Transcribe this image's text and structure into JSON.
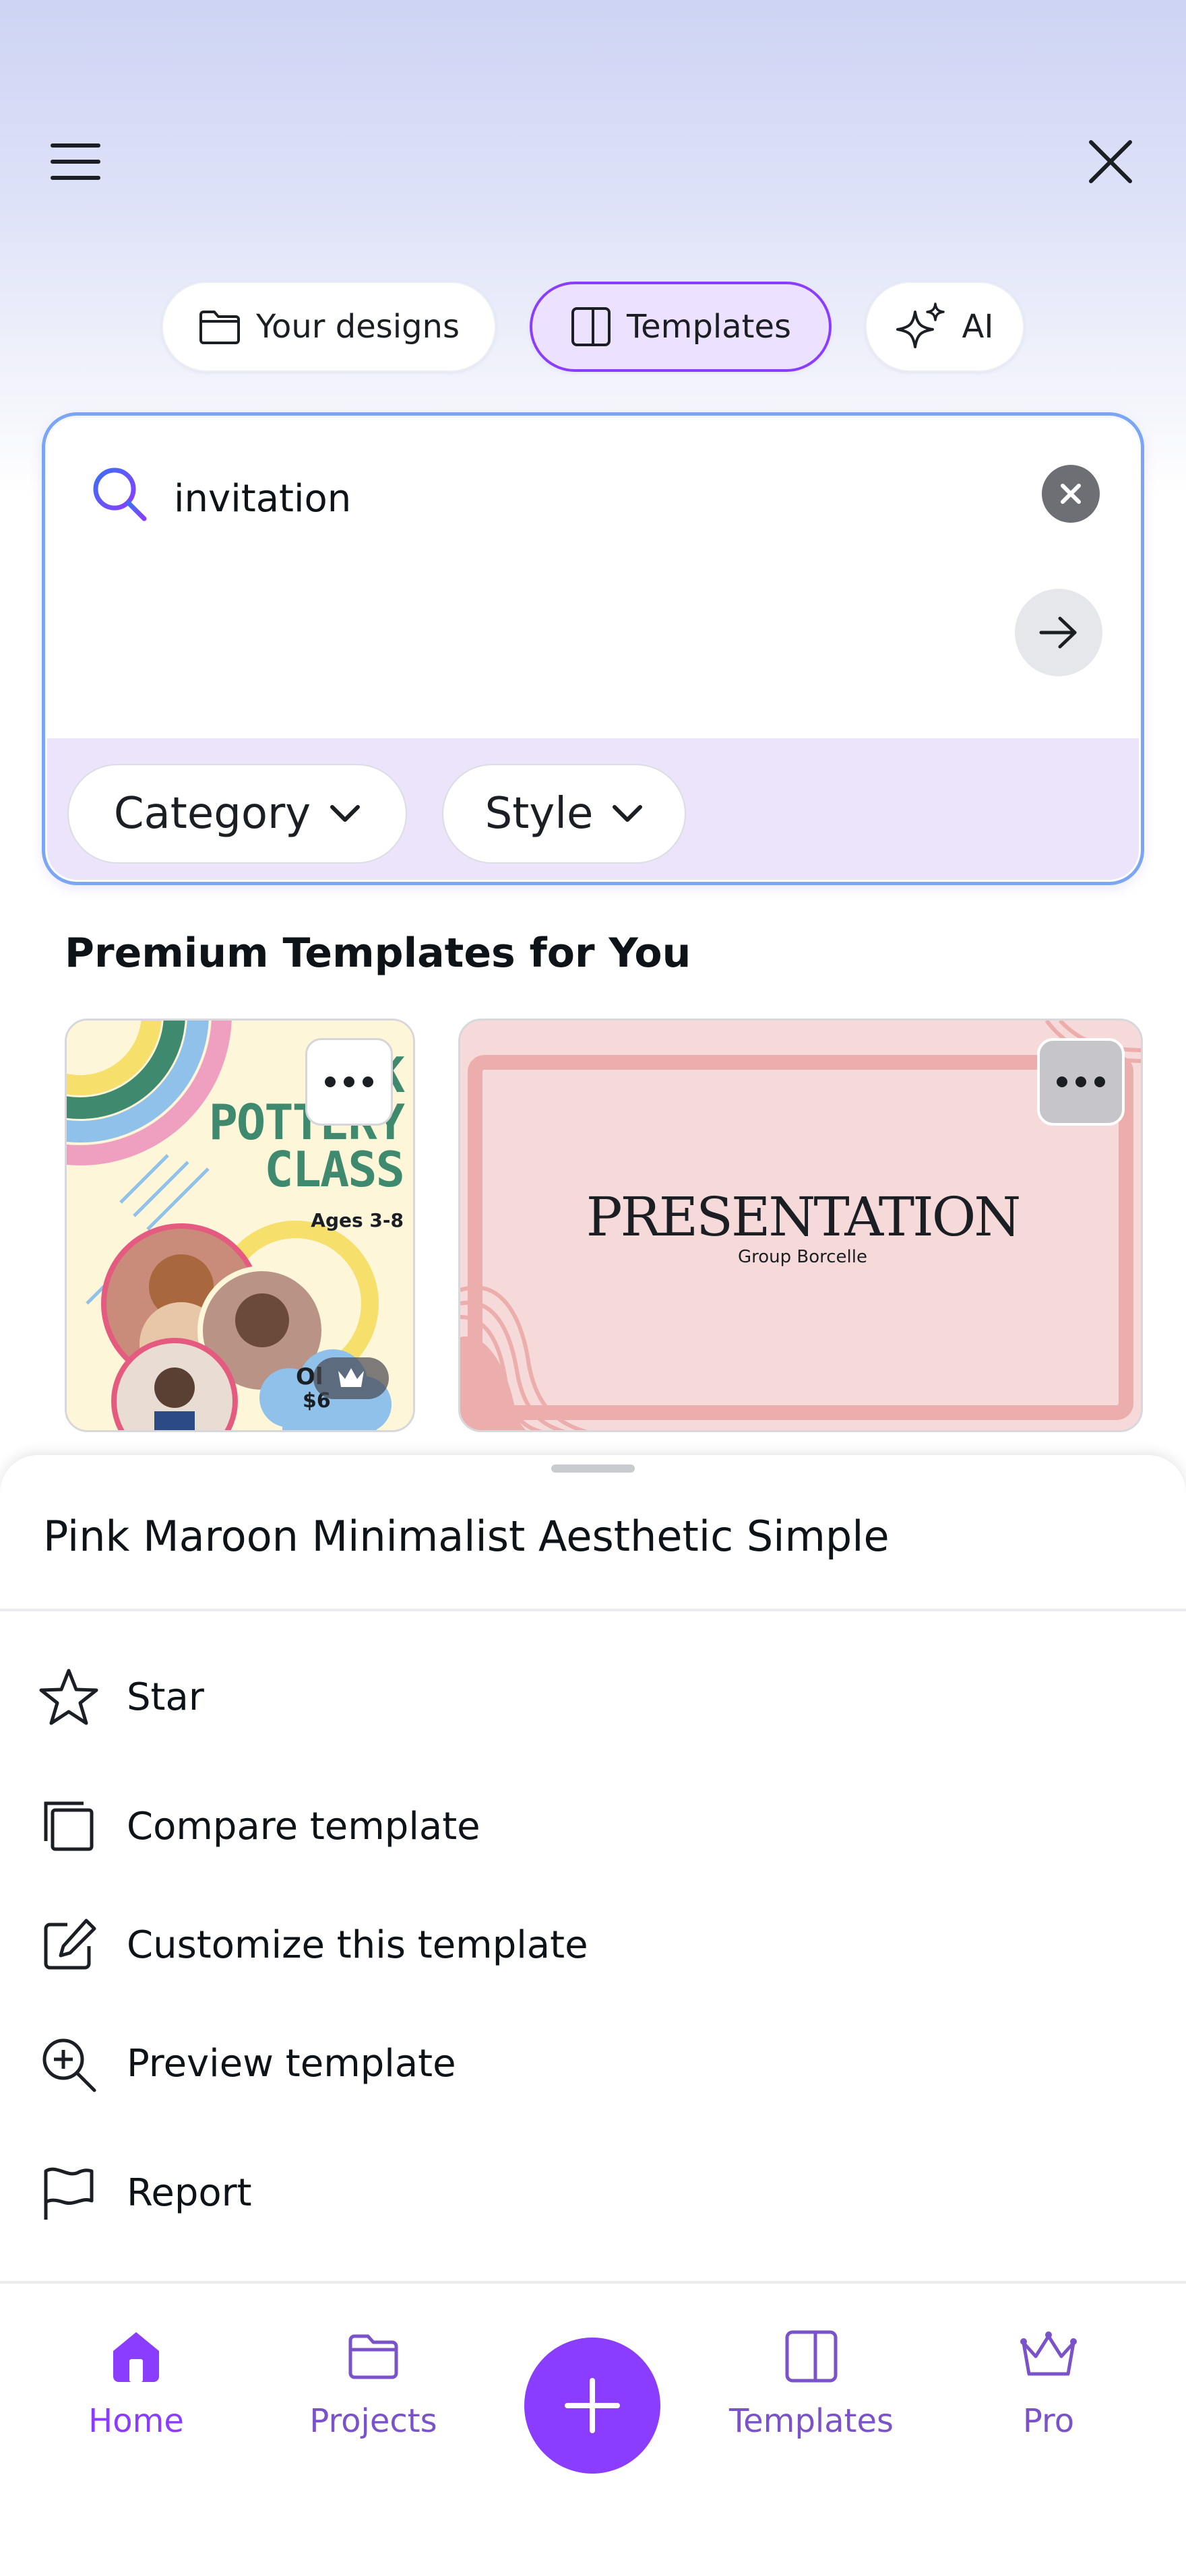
{
  "top_bar": {
    "menu_icon": "hamburger-menu-icon",
    "close_icon": "close-icon"
  },
  "tabs": [
    {
      "label": "Your designs",
      "icon": "folder-icon",
      "active": false
    },
    {
      "label": "Templates",
      "icon": "template-icon",
      "active": true
    },
    {
      "label": "AI",
      "icon": "sparkle-icon",
      "active": false
    }
  ],
  "search": {
    "value": "invitation",
    "icon": "search-icon",
    "clear_icon": "clear-icon",
    "submit_icon": "arrow-right-icon",
    "filters": [
      {
        "label": "Category",
        "icon": "chevron-down-icon"
      },
      {
        "label": "Style",
        "icon": "chevron-down-icon"
      }
    ]
  },
  "section": {
    "title": "Premium Templates for You"
  },
  "templates": [
    {
      "poster_lines": [
        "K",
        "POTTERY",
        "CLASS"
      ],
      "ages": "Ages 3-8",
      "more_icon": "more-horizontal-icon",
      "badge_icon": "crown-icon",
      "colors": {
        "bg": "#fdf6d8",
        "green": "#3f8a6e",
        "blue": "#8fc1ea",
        "pink": "#ef9fc0",
        "yellow": "#f6df6b"
      }
    },
    {
      "title": "PRESENTATION",
      "subtitle": "Group Borcelle",
      "more_icon": "more-horizontal-icon",
      "colors": {
        "bg": "#f6dad9",
        "frame": "#ecaeac"
      }
    }
  ],
  "sheet": {
    "title": "Pink Maroon Minimalist Aesthetic Simple",
    "items": [
      {
        "label": "Star",
        "icon": "star-icon"
      },
      {
        "label": "Compare template",
        "icon": "compare-icon"
      },
      {
        "label": "Customize this template",
        "icon": "edit-icon"
      },
      {
        "label": "Preview template",
        "icon": "zoom-in-icon"
      },
      {
        "label": "Report",
        "icon": "flag-icon"
      }
    ]
  },
  "bottom_nav": {
    "items": [
      {
        "label": "Home",
        "icon": "home-icon",
        "active": true
      },
      {
        "label": "Projects",
        "icon": "folder-icon",
        "active": false
      },
      {
        "label": "Templates",
        "icon": "template-icon",
        "active": false
      },
      {
        "label": "Pro",
        "icon": "crown-icon",
        "active": false
      }
    ],
    "create_icon": "plus-icon"
  },
  "colors": {
    "accent": "#8b3dff",
    "accent_light": "#ece2ff",
    "nav_text": "#7a52c9"
  }
}
